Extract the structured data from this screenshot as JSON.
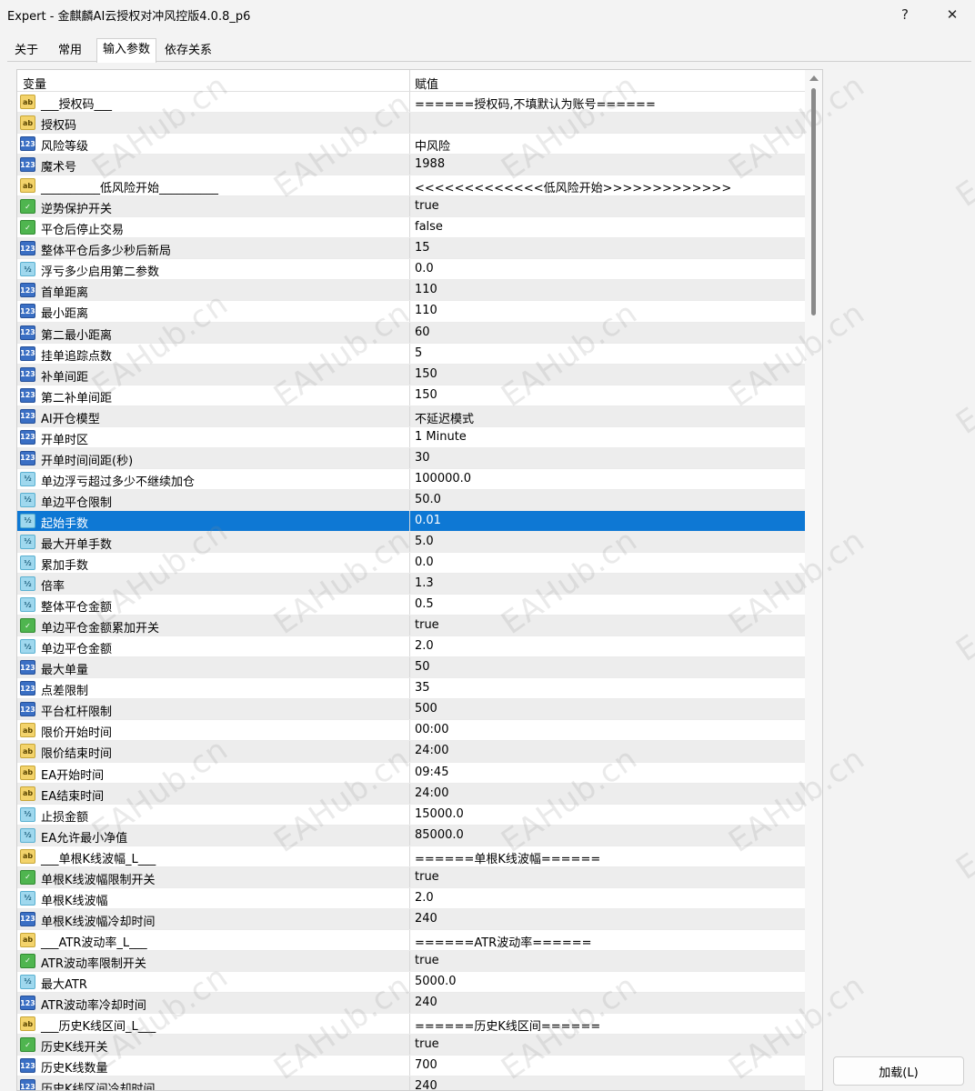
{
  "window": {
    "title": "Expert - 金麒麟AI云授权对冲风控版4.0.8_p6",
    "help_label": "?",
    "close_label": "✕"
  },
  "tabs": [
    {
      "label": "关于"
    },
    {
      "label": "常用"
    },
    {
      "label": "输入参数"
    },
    {
      "label": "依存关系"
    }
  ],
  "grid": {
    "col_variable": "变量",
    "col_value": "赋值",
    "selected_index": 20,
    "rows": [
      {
        "type": "ab",
        "variable": "___授权码___",
        "value": "======授权码,不填默认为账号======"
      },
      {
        "type": "ab",
        "variable": "授权码",
        "value": ""
      },
      {
        "type": "num",
        "variable": "风险等级",
        "value": "中风险"
      },
      {
        "type": "num",
        "variable": "魔术号",
        "value": "1988"
      },
      {
        "type": "ab",
        "variable": "__________低风险开始__________",
        "value": "<<<<<<<<<<<<<低风险开始>>>>>>>>>>>>>"
      },
      {
        "type": "bool",
        "variable": "逆势保护开关",
        "value": "true"
      },
      {
        "type": "bool",
        "variable": "平仓后停止交易",
        "value": "false"
      },
      {
        "type": "num",
        "variable": "整体平仓后多少秒后新局",
        "value": "15"
      },
      {
        "type": "dbl",
        "variable": "浮亏多少启用第二参数",
        "value": "0.0"
      },
      {
        "type": "num",
        "variable": "首单距离",
        "value": "110"
      },
      {
        "type": "num",
        "variable": "最小距离",
        "value": "110"
      },
      {
        "type": "num",
        "variable": "第二最小距离",
        "value": "60"
      },
      {
        "type": "num",
        "variable": "挂单追踪点数",
        "value": "5"
      },
      {
        "type": "num",
        "variable": "补单间距",
        "value": "150"
      },
      {
        "type": "num",
        "variable": "第二补单间距",
        "value": "150"
      },
      {
        "type": "num",
        "variable": "AI开仓模型",
        "value": "不延迟模式"
      },
      {
        "type": "num",
        "variable": "开单时区",
        "value": "1 Minute"
      },
      {
        "type": "num",
        "variable": "开单时间间距(秒)",
        "value": "30"
      },
      {
        "type": "dbl",
        "variable": "单边浮亏超过多少不继续加仓",
        "value": "100000.0"
      },
      {
        "type": "dbl",
        "variable": "单边平仓限制",
        "value": "50.0"
      },
      {
        "type": "dbl",
        "variable": "起始手数",
        "value": "0.01"
      },
      {
        "type": "dbl",
        "variable": "最大开单手数",
        "value": "5.0"
      },
      {
        "type": "dbl",
        "variable": "累加手数",
        "value": "0.0"
      },
      {
        "type": "dbl",
        "variable": "倍率",
        "value": "1.3"
      },
      {
        "type": "dbl",
        "variable": "整体平仓金额",
        "value": "0.5"
      },
      {
        "type": "bool",
        "variable": "单边平仓金额累加开关",
        "value": "true"
      },
      {
        "type": "dbl",
        "variable": "单边平仓金额",
        "value": "2.0"
      },
      {
        "type": "num",
        "variable": "最大单量",
        "value": "50"
      },
      {
        "type": "num",
        "variable": "点差限制",
        "value": "35"
      },
      {
        "type": "num",
        "variable": "平台杠杆限制",
        "value": "500"
      },
      {
        "type": "ab",
        "variable": "限价开始时间",
        "value": "00:00"
      },
      {
        "type": "ab",
        "variable": "限价结束时间",
        "value": "24:00"
      },
      {
        "type": "ab",
        "variable": "EA开始时间",
        "value": "09:45"
      },
      {
        "type": "ab",
        "variable": "EA结束时间",
        "value": "24:00"
      },
      {
        "type": "dbl",
        "variable": "止损金额",
        "value": "15000.0"
      },
      {
        "type": "dbl",
        "variable": "EA允许最小净值",
        "value": "85000.0"
      },
      {
        "type": "ab",
        "variable": "___单根K线波幅_L___",
        "value": "======单根K线波幅======"
      },
      {
        "type": "bool",
        "variable": "单根K线波幅限制开关",
        "value": "true"
      },
      {
        "type": "dbl",
        "variable": "单根K线波幅",
        "value": "2.0"
      },
      {
        "type": "num",
        "variable": "单根K线波幅冷却时间",
        "value": "240"
      },
      {
        "type": "ab",
        "variable": "___ATR波动率_L___",
        "value": "======ATR波动率======"
      },
      {
        "type": "bool",
        "variable": "ATR波动率限制开关",
        "value": "true"
      },
      {
        "type": "dbl",
        "variable": "最大ATR",
        "value": "5000.0"
      },
      {
        "type": "num",
        "variable": "ATR波动率冷却时间",
        "value": "240"
      },
      {
        "type": "ab",
        "variable": "___历史K线区间_L___",
        "value": "======历史K线区间======"
      },
      {
        "type": "bool",
        "variable": "历史K线开关",
        "value": "true"
      },
      {
        "type": "num",
        "variable": "历史K线数量",
        "value": "700"
      },
      {
        "type": "num",
        "variable": "历史K线区间冷却时间",
        "value": "240"
      }
    ]
  },
  "icons": {
    "ab": "ab",
    "num": "123",
    "dbl": "½",
    "bool": "✓"
  },
  "watermark_text": "EAHub.cn",
  "load_button_label": "加载(L)",
  "colors": {
    "selected_row": "#0e78d4",
    "odd_row": "#ededed"
  }
}
